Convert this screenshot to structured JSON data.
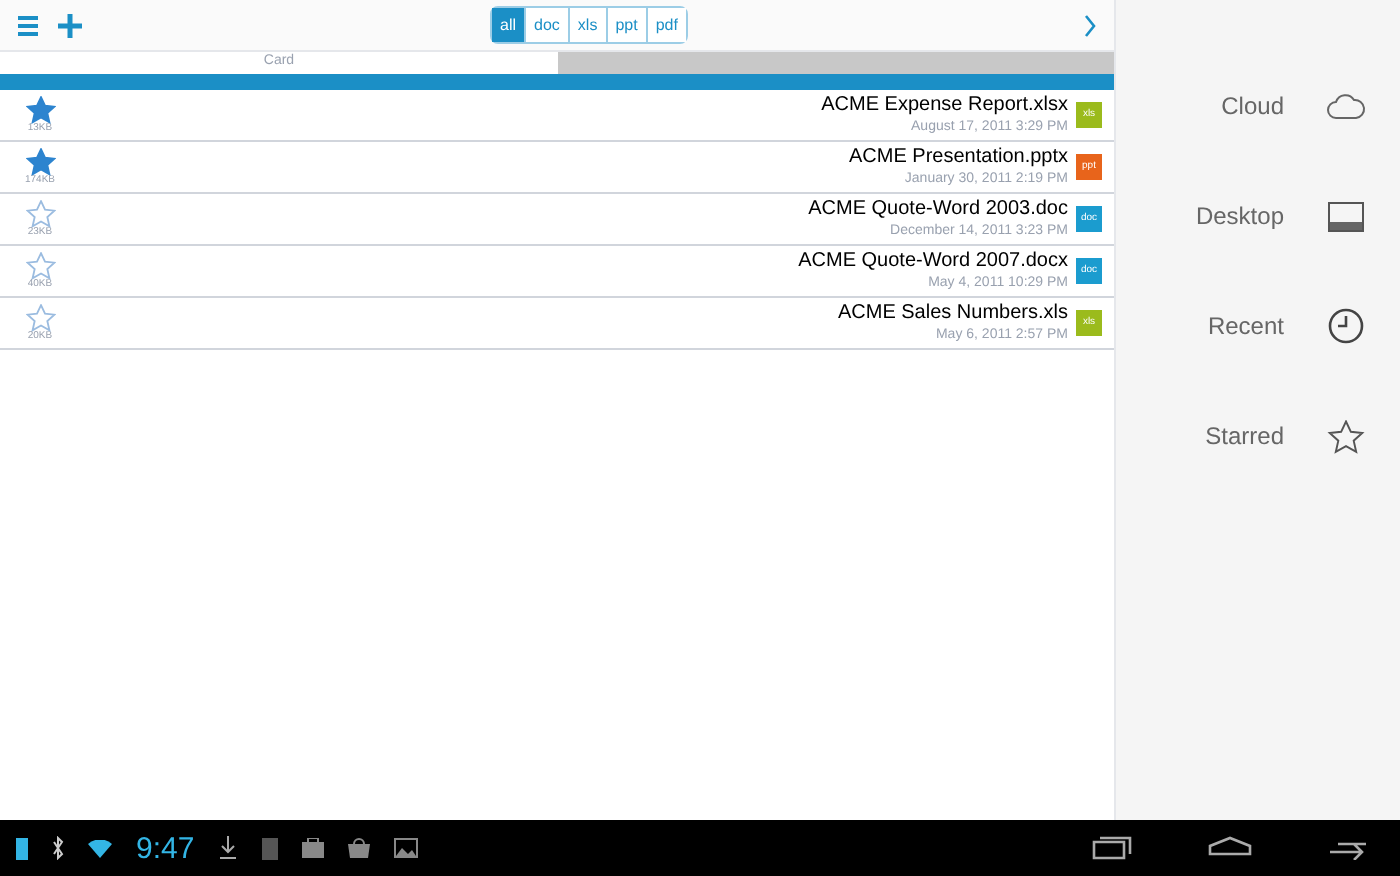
{
  "toolbar": {
    "filters": [
      {
        "label": "all",
        "selected": true
      },
      {
        "label": "doc",
        "selected": false
      },
      {
        "label": "xls",
        "selected": false
      },
      {
        "label": "ppt",
        "selected": false
      },
      {
        "label": "pdf",
        "selected": false
      }
    ]
  },
  "header": {
    "column": "Card"
  },
  "files": [
    {
      "name": "ACME Expense Report.xlsx",
      "date": "August 17, 2011 3:29 PM",
      "size": "13KB",
      "badge": "xls",
      "color": "#9bbb1c",
      "starred": true
    },
    {
      "name": "ACME Presentation.pptx",
      "date": "January 30, 2011 2:19 PM",
      "size": "174KB",
      "badge": "ppt",
      "color": "#e8641b",
      "starred": true
    },
    {
      "name": "ACME Quote-Word 2003.doc",
      "date": "December 14, 2011 3:23 PM",
      "size": "23KB",
      "badge": "doc",
      "color": "#1b9ccf",
      "starred": false
    },
    {
      "name": "ACME Quote-Word 2007.docx",
      "date": "May 4, 2011 10:29 PM",
      "size": "40KB",
      "badge": "doc",
      "color": "#1b9ccf",
      "starred": false
    },
    {
      "name": "ACME Sales Numbers.xls",
      "date": "May 6, 2011 2:57 PM",
      "size": "20KB",
      "badge": "xls",
      "color": "#9bbb1c",
      "starred": false
    }
  ],
  "sidebar": {
    "items": [
      {
        "label": "Cloud",
        "kind": "cloud"
      },
      {
        "label": "Desktop",
        "kind": "desktop"
      },
      {
        "label": "Recent",
        "kind": "recent"
      },
      {
        "label": "Starred",
        "kind": "starred"
      }
    ]
  },
  "status_bar": {
    "time": "9:47"
  }
}
